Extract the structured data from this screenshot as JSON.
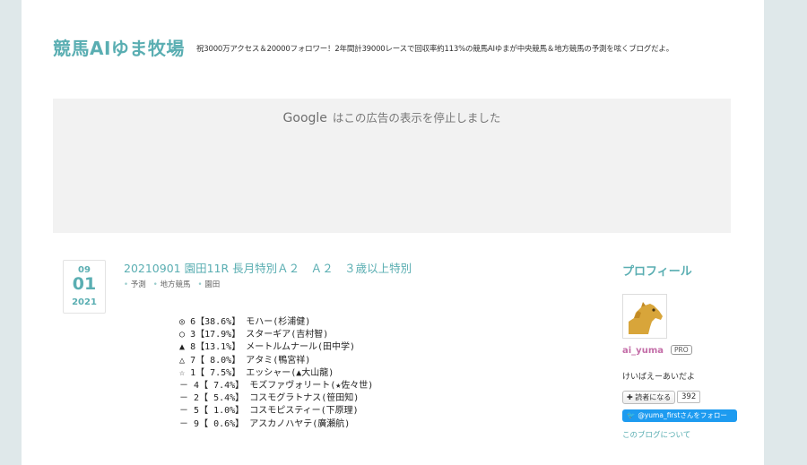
{
  "header": {
    "title": "競馬AIゆま牧場",
    "description": "祝3000万アクセス＆20000フォロワー！2年間計39000レースで回収率約113%の競馬AIゆまが中央競馬＆地方競馬の予測を呟くブログだよ。"
  },
  "ad": {
    "google": "Google",
    "message": "はこの広告の表示を停止しました"
  },
  "entry": {
    "date": {
      "month": "09",
      "day": "01",
      "year": "2021"
    },
    "title": "20210901 園田11R 長月特別Ａ２　Ａ２　３歳以上特別",
    "categories": [
      "予測",
      "地方競馬",
      "園田"
    ],
    "predictions": [
      {
        "mark": "◎",
        "num": "6",
        "pct": "38.6%",
        "horse": "モハー(杉浦健)"
      },
      {
        "mark": "○",
        "num": "3",
        "pct": "17.9%",
        "horse": "スターギア(吉村智)"
      },
      {
        "mark": "▲",
        "num": "8",
        "pct": "13.1%",
        "horse": "メートルムナール(田中学)"
      },
      {
        "mark": "△",
        "num": "7",
        "pct": " 8.0%",
        "horse": "アタミ(鴨宮祥)"
      },
      {
        "mark": "☆",
        "num": "1",
        "pct": " 7.5%",
        "horse": "エッシャー(▲大山龍)"
      },
      {
        "mark": "－",
        "num": "4",
        "pct": " 7.4%",
        "horse": "モズファヴォリート(★佐々世)"
      },
      {
        "mark": "－",
        "num": "2",
        "pct": " 5.4%",
        "horse": "コスモグラトナス(笹田知)"
      },
      {
        "mark": "－",
        "num": "5",
        "pct": " 1.0%",
        "horse": "コスモピスティー(下原理)"
      },
      {
        "mark": "－",
        "num": "9",
        "pct": " 0.6%",
        "horse": "アスカノハヤテ(廣瀬航)"
      }
    ]
  },
  "sidebar": {
    "title": "プロフィール",
    "user_id": "ai_yuma",
    "pro_badge": "PRO",
    "bio": "けいばえーあいだよ",
    "reader_button": "読者になる",
    "reader_count": "392",
    "twitter_follow": "@yuma_firstさんをフォロー",
    "about_link": "このブログについて"
  },
  "colors": {
    "accent": "#5aaeb2",
    "background": "#dfe8ea",
    "twitter": "#1d9bf0",
    "user_id": "#c36ca7"
  }
}
